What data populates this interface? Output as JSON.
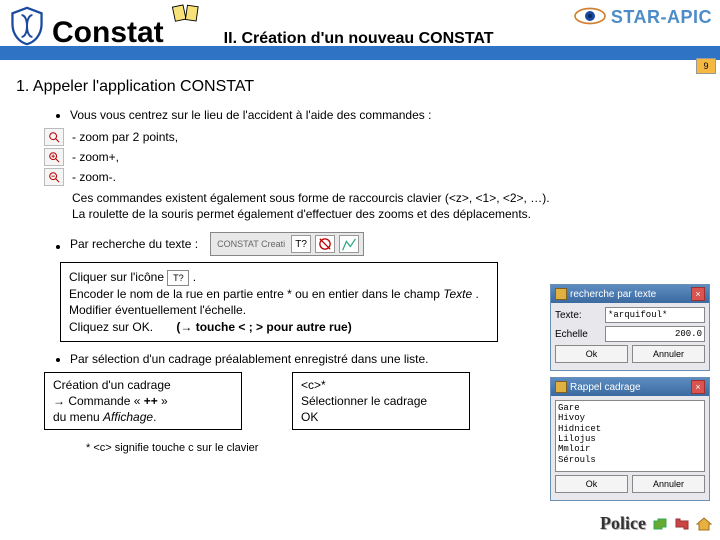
{
  "header": {
    "app_title": "Constat",
    "section_title": "II.  Création d'un nouveau CONSTAT",
    "logo_text": "STAR-APIC",
    "page_number": "9"
  },
  "subsection": "1. Appeler l'application CONSTAT",
  "intro_bullet": "Vous vous centrez sur le lieu de l'accident à l'aide des commandes :",
  "zooms": {
    "z1": "- zoom par 2 points,",
    "z2": "- zoom+,",
    "z3": "- zoom-."
  },
  "para1": "Ces commandes existent également sous forme de raccourcis clavier (<z>, <1>, <2>, …).",
  "para2": "La roulette de la souris permet également d'effectuer des zooms et des déplacements.",
  "search_bullet": "Par recherche du texte :",
  "box_search": {
    "l1a": "Cliquer sur l'icône ",
    "l1b": ".",
    "l2a": "Encoder le nom de la rue en partie entre  *   ou en entier dans le champ ",
    "l2b": "Texte",
    "l2c": ".",
    "l3": "Modifier éventuellement l'échelle.",
    "l4": "Cliquez sur OK.",
    "l4b": "(→ touche  < ; > pour autre rue)"
  },
  "cadrage_bullet": "Par sélection d'un cadrage préalablement enregistré dans une liste.",
  "box_cadrage_create": {
    "l1": "Création d'un cadrage",
    "l2a": "→ Commande « ",
    "l2b": "++",
    "l2c": " »",
    "l3a": "du menu ",
    "l3b": "Affichage",
    "l3c": "."
  },
  "box_cadrage_sel": {
    "l1": "<c>*",
    "l2": "Sélectionner le cadrage",
    "l3": "OK"
  },
  "footnote": "*   <c> signifie touche c sur le clavier",
  "dialog_search": {
    "title": "recherche par texte",
    "label_texte": "Texte:",
    "value_texte": "*arquifoul*",
    "label_echelle": "Echelle",
    "value_echelle": "200.0",
    "btn_ok": "Ok",
    "btn_cancel": "Annuler"
  },
  "dialog_rappel": {
    "title": "Rappel cadrage",
    "items": [
      "Gare",
      "Hivoy",
      "Hidnicet",
      "Lilojus",
      "Mmloir",
      "Sérouls",
      ""
    ],
    "btn_ok": "Ok",
    "btn_cancel": "Annuler"
  },
  "footer": {
    "police": "Police"
  }
}
